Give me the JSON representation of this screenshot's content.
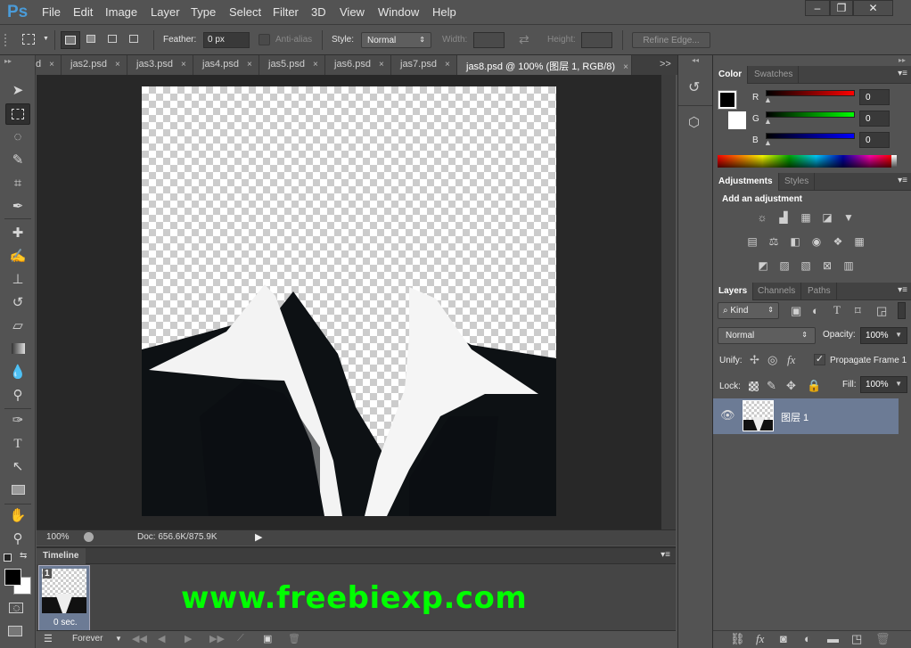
{
  "app": {
    "logo": "Ps"
  },
  "menu": [
    "File",
    "Edit",
    "Image",
    "Layer",
    "Type",
    "Select",
    "Filter",
    "3D",
    "View",
    "Window",
    "Help"
  ],
  "window_controls": {
    "minimize": "–",
    "restore": "❐",
    "close": "✕"
  },
  "options": {
    "feather_label": "Feather:",
    "feather_value": "0 px",
    "antialias_label": "Anti-alias",
    "antialias_checked": false,
    "style_label": "Style:",
    "style_value": "Normal",
    "width_label": "Width:",
    "height_label": "Height:",
    "refine_edge": "Refine Edge..."
  },
  "tabs": [
    {
      "label": "d"
    },
    {
      "label": "jas2.psd"
    },
    {
      "label": "jas3.psd"
    },
    {
      "label": "jas4.psd"
    },
    {
      "label": "jas5.psd"
    },
    {
      "label": "jas6.psd"
    },
    {
      "label": "jas7.psd"
    },
    {
      "label": "jas8.psd @ 100% (图层 1, RGB/8)",
      "active": true
    }
  ],
  "tab_close": "×",
  "tab_overflow": ">>",
  "status": {
    "zoom": "100%",
    "doc": "Doc: 656.6K/875.9K"
  },
  "timeline": {
    "title": "Timeline",
    "frame_number": "1",
    "frame_delay": "0 sec.",
    "loop": "Forever"
  },
  "watermark": "www.freebiexp.com",
  "color_panel": {
    "tabs": [
      "Color",
      "Swatches"
    ],
    "channels": [
      {
        "label": "R",
        "value": "0",
        "color": "#ff0000"
      },
      {
        "label": "G",
        "value": "0",
        "color": "#00ff00"
      },
      {
        "label": "B",
        "value": "0",
        "color": "#0000ff"
      }
    ],
    "foreground": "#000000",
    "background": "#ffffff"
  },
  "adjustments_panel": {
    "tabs": [
      "Adjustments",
      "Styles"
    ],
    "heading": "Add an adjustment"
  },
  "layers_panel": {
    "tabs": [
      "Layers",
      "Channels",
      "Paths"
    ],
    "filter_kind": "Kind",
    "blend_mode": "Normal",
    "opacity_label": "Opacity:",
    "opacity": "100%",
    "unify_label": "Unify:",
    "propagate_label": "Propagate Frame 1",
    "propagate_checked": true,
    "lock_label": "Lock:",
    "fill_label": "Fill:",
    "fill": "100%",
    "layers": [
      {
        "name": "图层 1",
        "visible": true,
        "selected": true
      }
    ]
  }
}
